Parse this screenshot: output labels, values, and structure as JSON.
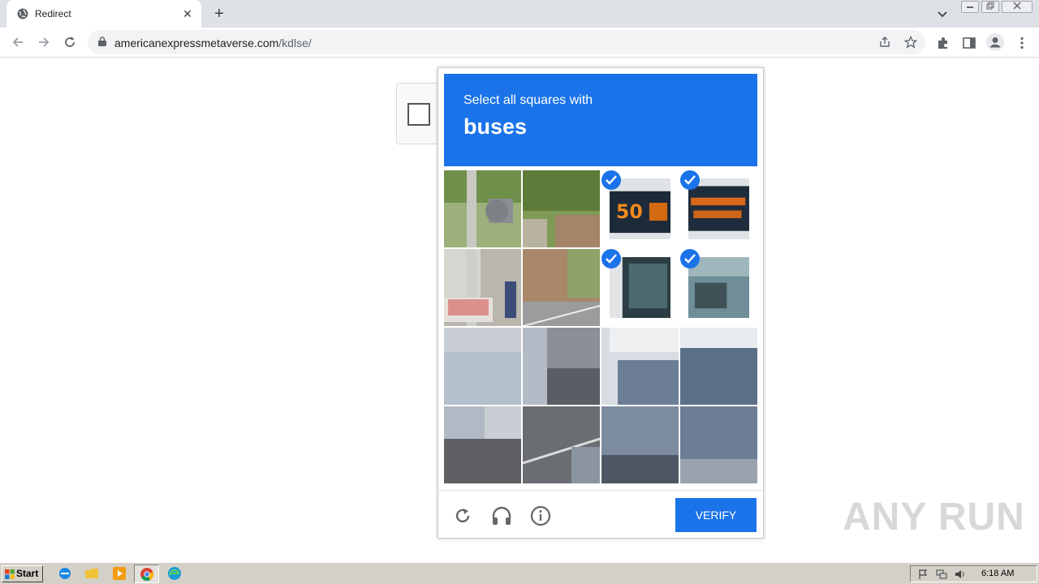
{
  "browser": {
    "tab_title": "Redirect",
    "tab_close": "✕",
    "new_tab": "+",
    "url_domain": "americanexpressmetaverse.com",
    "url_path": "/kdlse/",
    "window_buttons": [
      "minimize",
      "restore",
      "close"
    ]
  },
  "captcha": {
    "prompt_small": "Select all squares with",
    "prompt_target": "buses",
    "verify_label": "VERIFY",
    "tiles": [
      {
        "selected": false
      },
      {
        "selected": false
      },
      {
        "selected": true
      },
      {
        "selected": true
      },
      {
        "selected": false
      },
      {
        "selected": false
      },
      {
        "selected": true
      },
      {
        "selected": true
      },
      {
        "selected": false
      },
      {
        "selected": false
      },
      {
        "selected": false
      },
      {
        "selected": false
      },
      {
        "selected": false
      },
      {
        "selected": false
      },
      {
        "selected": false
      },
      {
        "selected": false
      }
    ],
    "footer_icons": [
      "reload-icon",
      "audio-headphones-icon",
      "info-icon"
    ],
    "accent_color": "#1a73e8"
  },
  "watermark": "ANY RUN",
  "taskbar": {
    "start_label": "Start",
    "apps": [
      "ie-icon",
      "folder-icon",
      "media-player-icon",
      "chrome-icon",
      "edge-icon"
    ],
    "clock": "6:18 AM"
  }
}
